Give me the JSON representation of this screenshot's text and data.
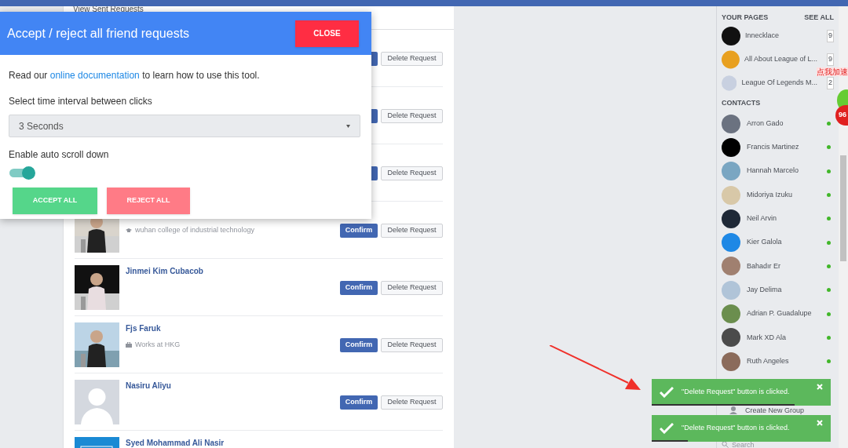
{
  "top_link": "View Sent Requests",
  "requests": [
    {
      "delete": "Delete Request"
    },
    {
      "delete": "Delete Request"
    },
    {
      "delete": "Delete Request"
    },
    {
      "kind": "picture",
      "subtitle": {
        "kind": "school",
        "text": "wuhan college of industrial technology"
      },
      "confirm": "Confirm",
      "delete": "Delete Request"
    },
    {
      "kind": "picture",
      "name": "Jinmei Kim Cubacob",
      "confirm": "Confirm",
      "delete": "Delete Request"
    },
    {
      "kind": "picture",
      "name": "Fjs Faruk",
      "subtitle": {
        "kind": "work",
        "text": "Works at HKG"
      },
      "confirm": "Confirm",
      "delete": "Delete Request"
    },
    {
      "kind": "silhouette",
      "name": "Nasiru Aliyu",
      "confirm": "Confirm",
      "delete": "Delete Request"
    },
    {
      "kind": "quote",
      "name": "Syed Mohammad Ali Nasir"
    }
  ],
  "modal": {
    "title": "Accept / reject all friend requests",
    "close": "CLOSE",
    "intro_before": "Read our ",
    "intro_link": "online documentation",
    "intro_after": " to learn how to use this tool.",
    "interval_label": "Select time interval between clicks",
    "interval_value": "3 Seconds",
    "autoscroll_label": "Enable auto scroll down",
    "autoscroll_on": true,
    "accept": "ACCEPT ALL",
    "reject": "REJECT ALL"
  },
  "sidebar": {
    "pages_heading": "YOUR PAGES",
    "see_all": "SEE ALL",
    "pages": [
      {
        "name": "Innecklace",
        "count": "9"
      },
      {
        "name": "All About League of L...",
        "count": "9"
      },
      {
        "name": "League Of Legends M...",
        "count": "2"
      }
    ],
    "contacts_heading": "CONTACTS",
    "contacts": [
      {
        "name": "Arron Gado",
        "online": true
      },
      {
        "name": "Francis Martinez",
        "online": true
      },
      {
        "name": "Hannah Marcelo",
        "online": true
      },
      {
        "name": "Midoriya Izuku",
        "online": true
      },
      {
        "name": "Neil Arvin",
        "online": true
      },
      {
        "name": "Kier Galola",
        "online": true
      },
      {
        "name": "Bahadır Er",
        "online": true
      },
      {
        "name": "Jay Delima",
        "online": true
      },
      {
        "name": "Adrian P. Guadalupe",
        "online": true
      },
      {
        "name": "Mark XD Ala",
        "online": true
      },
      {
        "name": "Ruth Angeles",
        "online": true
      }
    ],
    "create_group": "Create New Group",
    "search_placeholder": "Search"
  },
  "toasts": [
    {
      "message": "\"Delete Request\" button is clicked.",
      "level": 0.8
    },
    {
      "message": "\"Delete Request\" button is clicked.",
      "level": 0.2
    }
  ],
  "widget": {
    "label": "点我加速",
    "badge": "96"
  }
}
